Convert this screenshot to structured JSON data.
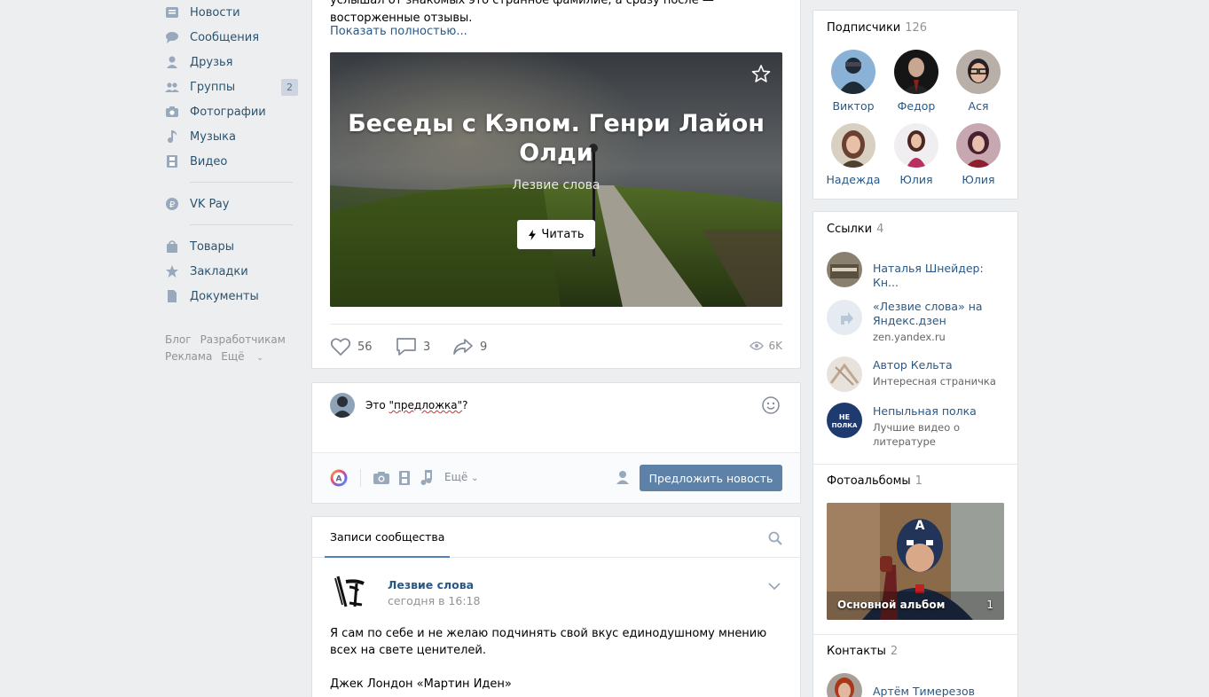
{
  "left_nav": {
    "items": [
      {
        "label": "Новости",
        "icon": "news-icon"
      },
      {
        "label": "Сообщения",
        "icon": "messages-icon"
      },
      {
        "label": "Друзья",
        "icon": "friends-icon"
      },
      {
        "label": "Группы",
        "icon": "groups-icon",
        "count": "2"
      },
      {
        "label": "Фотографии",
        "icon": "camera-icon"
      },
      {
        "label": "Музыка",
        "icon": "music-note-icon"
      },
      {
        "label": "Видео",
        "icon": "film-icon"
      },
      {
        "label": "VK Pay",
        "icon": "ruble-icon"
      },
      {
        "label": "Товары",
        "icon": "shopping-bag-icon"
      },
      {
        "label": "Закладки",
        "icon": "star-icon"
      },
      {
        "label": "Документы",
        "icon": "document-icon"
      }
    ],
    "footer": [
      "Блог",
      "Разработчикам",
      "Реклама",
      "Ещё"
    ]
  },
  "post_top": {
    "text_tail": "услышал от знакомых это странное фамилие, а сразу после — восторженные отзывы.",
    "show_more": "Показать полностью...",
    "article": {
      "title": "Беседы с Кэпом. Генри Лайон Олди",
      "subtitle": "Лезвие слова",
      "read_label": "Читать"
    },
    "likes": "56",
    "comments": "3",
    "shares": "9",
    "views": "6K"
  },
  "suggest": {
    "text_before": "Это ",
    "text_quoted": "\"предложка\"",
    "text_after": "?",
    "more_label": "Ещё",
    "submit_label": "Предложить новость"
  },
  "wall": {
    "tab_label": "Записи сообщества",
    "post": {
      "author": "Лезвие слова",
      "date": "сегодня в 16:18",
      "text_line1": "Я сам по себе и не желаю подчинять свой вкус единодушному мнению всех на свете ценителей.",
      "text_line2": "Джек Лондон «Мартин Иден»"
    }
  },
  "subscribers": {
    "title": "Подписчики",
    "count": "126",
    "people": [
      "Виктор",
      "Федор",
      "Ася",
      "Надежда",
      "Юлия",
      "Юлия"
    ]
  },
  "links": {
    "title": "Ссылки",
    "count": "4",
    "items": [
      {
        "title": "Наталья Шнейдер: Кн...",
        "desc": ""
      },
      {
        "title": "«Лезвие слова» на Яндекс.дзен",
        "desc": "zen.yandex.ru"
      },
      {
        "title": "Автор Кельта",
        "desc": "Интересная страничка"
      },
      {
        "title": "Непыльная полка",
        "desc": "Лучшие видео о литературе"
      }
    ]
  },
  "albums": {
    "title": "Фотоальбомы",
    "count": "1",
    "album_name": "Основной альбом",
    "album_count": "1"
  },
  "contacts": {
    "title": "Контакты",
    "count": "2",
    "first_name": "Артём Тимерезов"
  }
}
